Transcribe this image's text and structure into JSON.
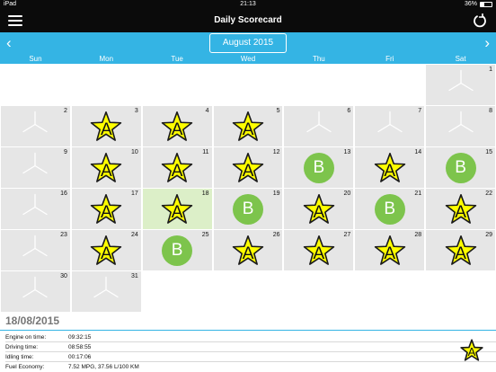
{
  "status_bar": {
    "device": "iPad",
    "time": "21:13",
    "battery": "36%",
    "battery_level": 0.36
  },
  "nav": {
    "title": "Daily Scorecard",
    "menu_icon": "hamburger-menu-icon",
    "refresh_icon": "refresh-icon"
  },
  "month_bar": {
    "month_label": "August 2015",
    "prev_icon": "chevron-left-icon",
    "next_icon": "chevron-right-icon"
  },
  "weekdays": [
    "Sun",
    "Mon",
    "Tue",
    "Wed",
    "Thu",
    "Fri",
    "Sat"
  ],
  "calendar": {
    "selected_day": "18",
    "weeks": [
      [
        null,
        null,
        null,
        null,
        null,
        null,
        {
          "day": "1",
          "grade": ""
        }
      ],
      [
        {
          "day": "2",
          "grade": ""
        },
        {
          "day": "3",
          "grade": "A"
        },
        {
          "day": "4",
          "grade": "A"
        },
        {
          "day": "5",
          "grade": "A"
        },
        {
          "day": "6",
          "grade": ""
        },
        {
          "day": "7",
          "grade": ""
        },
        {
          "day": "8",
          "grade": ""
        }
      ],
      [
        {
          "day": "9",
          "grade": ""
        },
        {
          "day": "10",
          "grade": "A"
        },
        {
          "day": "11",
          "grade": "A"
        },
        {
          "day": "12",
          "grade": "A"
        },
        {
          "day": "13",
          "grade": "B"
        },
        {
          "day": "14",
          "grade": "A"
        },
        {
          "day": "15",
          "grade": "B"
        }
      ],
      [
        {
          "day": "16",
          "grade": ""
        },
        {
          "day": "17",
          "grade": "A"
        },
        {
          "day": "18",
          "grade": "A"
        },
        {
          "day": "19",
          "grade": "B"
        },
        {
          "day": "20",
          "grade": "A"
        },
        {
          "day": "21",
          "grade": "B"
        },
        {
          "day": "22",
          "grade": "A"
        }
      ],
      [
        {
          "day": "23",
          "grade": ""
        },
        {
          "day": "24",
          "grade": "A"
        },
        {
          "day": "25",
          "grade": "B"
        },
        {
          "day": "26",
          "grade": "A"
        },
        {
          "day": "27",
          "grade": "A"
        },
        {
          "day": "28",
          "grade": "A"
        },
        {
          "day": "29",
          "grade": "A"
        }
      ],
      [
        {
          "day": "30",
          "grade": ""
        },
        {
          "day": "31",
          "grade": ""
        },
        null,
        null,
        null,
        null,
        null
      ]
    ]
  },
  "grade_styles": {
    "A": {
      "shape": "star",
      "color": "#ffff00",
      "stroke": "#1a1a1a"
    },
    "B": {
      "shape": "circle",
      "color": "#7dc44c"
    },
    "none": {
      "icon": "no-data-icon",
      "color": "#ffffff"
    }
  },
  "detail": {
    "date": "18/08/2015",
    "stats": [
      {
        "label": "Engine on time:",
        "value": "09:32:15"
      },
      {
        "label": "Driving time:",
        "value": "08:58:55"
      },
      {
        "label": "Idling time:",
        "value": "00:17:06"
      },
      {
        "label": "Fuel Economy:",
        "value": "7.52 MPG, 37.56 L/100 KM"
      }
    ],
    "grade": "A"
  },
  "colors": {
    "accent": "#34b4e4",
    "nav": "#0b0b0b",
    "cell": "#e6e6e6",
    "selected_cell": "#dcefc8"
  }
}
